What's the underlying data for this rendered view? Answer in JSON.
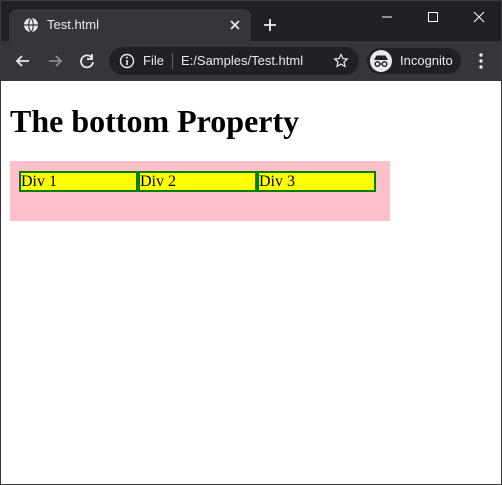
{
  "browser": {
    "tab": {
      "title": "Test.html"
    },
    "address_bar": {
      "scheme_label": "File",
      "url": "E:/Samples/Test.html"
    },
    "profile": {
      "label": "Incognito"
    }
  },
  "page": {
    "heading": "The bottom Property",
    "boxes": [
      {
        "label": "Div 1"
      },
      {
        "label": "Div 2"
      },
      {
        "label": "Div 3"
      }
    ]
  },
  "colors": {
    "titlebar": "#202124",
    "toolbar": "#35363a",
    "container_bg": "#ffc0cb",
    "box_bg": "#ffff00",
    "box_border": "#008000"
  }
}
